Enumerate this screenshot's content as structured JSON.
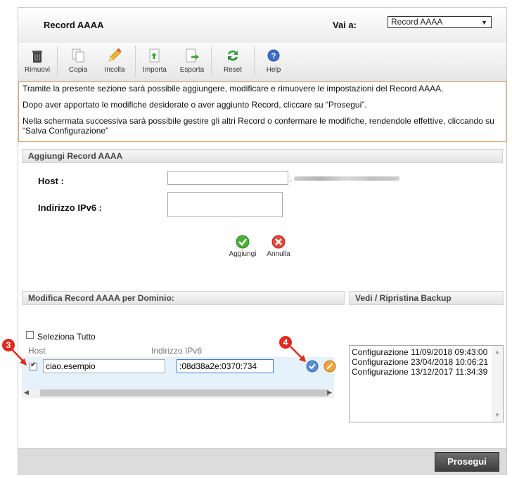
{
  "header": {
    "title": "Record AAAA",
    "goto_label": "Vai a:",
    "goto_value": "Record AAAA"
  },
  "toolbar": [
    {
      "name": "remove",
      "label": "Rimuovi",
      "icon": "trash-icon"
    },
    {
      "name": "copy",
      "label": "Copia",
      "icon": "copy-icon"
    },
    {
      "name": "paste",
      "label": "Incolla",
      "icon": "pencil-icon"
    },
    {
      "name": "import",
      "label": "Importa",
      "icon": "import-icon"
    },
    {
      "name": "export",
      "label": "Esporta",
      "icon": "export-icon"
    },
    {
      "name": "reset",
      "label": "Reset",
      "icon": "reset-icon"
    },
    {
      "name": "help",
      "label": "Help",
      "icon": "help-icon"
    }
  ],
  "info": {
    "line1": "Tramite la presente sezione sarà possibile aggiungere, modificare e rimuovere le impostazioni del Record AAAA.",
    "line2": "Dopo aver apportato le modifiche desiderate o aver aggiunto Record, cliccare su “Prosegui”.",
    "line3": "Nella schermata successiva sarà possibile gestire gli altri Record o confermare le modifiche, rendendole effettive, cliccando su “Salva Configurazione”"
  },
  "add_section": {
    "title": "Aggiungi Record AAAA",
    "host_label": "Host :",
    "host_value": "",
    "host_suffix": ".",
    "ipv6_label": "Indirizzo IPv6 :",
    "ipv6_value": "",
    "add_label": "Aggiungi",
    "cancel_label": "Annulla"
  },
  "modify_section": {
    "title": "Modifica Record AAAA per Dominio:",
    "select_all_label": "Seleziona Tutto",
    "col_host": "Host",
    "col_ipv6": "Indirizzo IPv6",
    "rows": [
      {
        "checked": true,
        "host": "ciao.esempio",
        "ipv6": ":08d38a2e:0370:734"
      }
    ]
  },
  "backup_section": {
    "title": "Vedi / Ripristina Backup",
    "items": [
      "Configurazione 11/09/2018 09:43:00",
      "Configurazione 23/04/2018 10:06:21",
      "Configurazione 13/12/2017 11:34:39"
    ]
  },
  "annotations": {
    "badge_left": "3",
    "badge_right": "4"
  },
  "footer": {
    "proceed_label": "Prosegui"
  },
  "colors": {
    "accent_red": "#e02a1e",
    "info_border": "#d9a36b",
    "row_bg": "#e5f1fb",
    "button_dark": "#4a4a4a"
  }
}
